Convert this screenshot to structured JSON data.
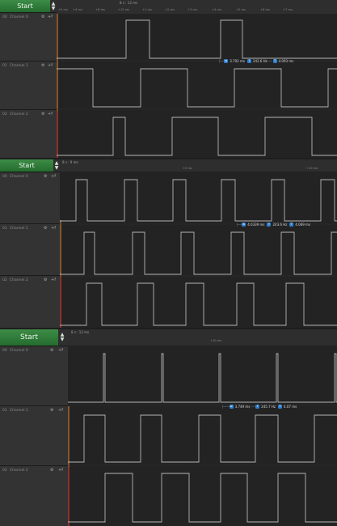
{
  "panels": [
    {
      "start_label": "Start",
      "range_text": "8 s : 12 ms",
      "ticks": [
        "+0 ms",
        "+4 ms",
        "+8 ms",
        "+12 ms",
        "+1 ms",
        "+2 ms",
        "+3 ms",
        "+4 ms",
        "+5 ms",
        "+6 ms",
        "+7 ms"
      ],
      "measurement": [
        "3.702 ms",
        "243.6 Hz",
        "4.093 ms"
      ],
      "channels": [
        {
          "num": "00",
          "name": "Channel 0"
        },
        {
          "num": "01",
          "name": "Channel 1"
        },
        {
          "num": "02",
          "name": "Channel 2"
        }
      ]
    },
    {
      "start_label": "Start",
      "range_text": "8 s : 9 ms",
      "ticks": [
        "+5 ms",
        "+10 ms"
      ],
      "measurement": [
        "4.0339 ms",
        "243.6 Hz",
        "4.069 ms"
      ],
      "channels": [
        {
          "num": "00",
          "name": "Channel 0"
        },
        {
          "num": "01",
          "name": "Channel 1"
        },
        {
          "num": "02",
          "name": "Channel 2"
        }
      ]
    },
    {
      "start_label": "Start",
      "range_text": "8 s : 12 ms",
      "ticks": [
        "+10 ms"
      ],
      "measurement": [
        "3.749 ms",
        "245.7 Hz",
        "4.07 ms"
      ],
      "channels": [
        {
          "num": "00",
          "name": "Channel 0"
        },
        {
          "num": "01",
          "name": "Channel 1"
        },
        {
          "num": "02",
          "name": "Channel 2"
        }
      ]
    }
  ],
  "icons": {
    "gear": "gear-icon",
    "zero": "plus-f-icon",
    "up": "chevron-up-icon",
    "down": "chevron-down-icon"
  },
  "colors": {
    "start": "#2f7f3a",
    "marker_orange": "#c87832",
    "marker_red": "#c03030",
    "trace": "#b5b5b5",
    "measure": "#2f7fd0"
  }
}
